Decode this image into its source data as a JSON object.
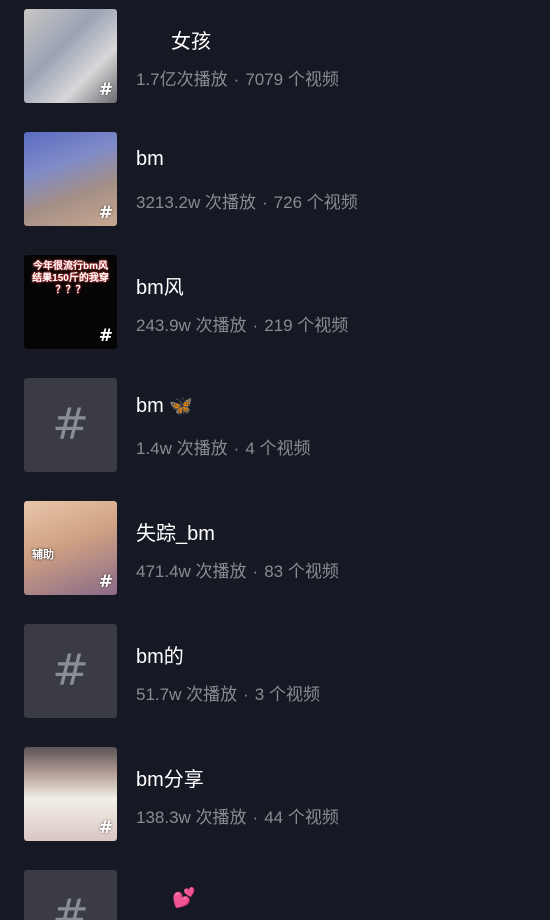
{
  "items": [
    {
      "title": "女孩",
      "plays": "1.7亿次播放",
      "videos": "7079 个视频",
      "thumb": "photo"
    },
    {
      "title": "bm",
      "plays": "3213.2w 次播放",
      "videos": "726 个视频",
      "thumb": "photo"
    },
    {
      "title": "bm风",
      "plays": "243.9w 次播放",
      "videos": "219 个视频",
      "thumb": "photo",
      "thumb_text": "今年很流行bm风 结果150斤的我穿 ？？？"
    },
    {
      "title": "bm",
      "emoji": "🦋",
      "plays": "1.4w 次播放",
      "videos": "4 个视频",
      "thumb": "placeholder"
    },
    {
      "title": "失踪_bm",
      "plays": "471.4w 次播放",
      "videos": "83 个视频",
      "thumb": "photo",
      "thumb_text": "辅助"
    },
    {
      "title": "bm的",
      "plays": "51.7w 次播放",
      "videos": "3 个视频",
      "thumb": "placeholder"
    },
    {
      "title": "bm分享",
      "plays": "138.3w 次播放",
      "videos": "44 个视频",
      "thumb": "photo"
    },
    {
      "title": "",
      "emoji": "💕",
      "plays": "",
      "videos": "",
      "thumb": "placeholder"
    }
  ],
  "separator": "·",
  "hash_symbol": "#",
  "icons": {
    "hashtag": "hashtag-icon"
  },
  "colors": {
    "background": "#161823",
    "title": "#ffffff",
    "meta": "#8a8b91",
    "placeholder": "#3a3b44"
  }
}
